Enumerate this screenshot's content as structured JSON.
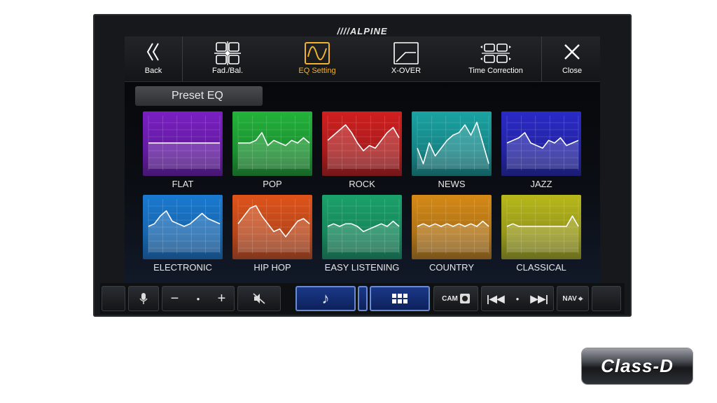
{
  "brand": "////ALPINE",
  "topbar": {
    "back": "Back",
    "fad_bal": "Fad./Bal.",
    "eq_setting": "EQ Setting",
    "xover": "X-OVER",
    "time_correction": "Time Correction",
    "close": "Close"
  },
  "preset_header": "Preset EQ",
  "presets": [
    {
      "name": "FLAT",
      "color": "#7a1fc4",
      "curve": [
        0.5,
        0.5,
        0.5,
        0.5,
        0.5,
        0.5,
        0.5,
        0.5,
        0.5,
        0.5,
        0.5,
        0.5,
        0.5
      ]
    },
    {
      "name": "POP",
      "color": "#22b33a",
      "curve": [
        0.5,
        0.5,
        0.5,
        0.45,
        0.3,
        0.55,
        0.45,
        0.5,
        0.55,
        0.45,
        0.5,
        0.4,
        0.5
      ]
    },
    {
      "name": "ROCK",
      "color": "#d11f1f",
      "curve": [
        0.45,
        0.35,
        0.25,
        0.15,
        0.3,
        0.5,
        0.65,
        0.55,
        0.6,
        0.45,
        0.3,
        0.2,
        0.4
      ]
    },
    {
      "name": "NEWS",
      "color": "#1aa3a3",
      "curve": [
        0.6,
        0.9,
        0.5,
        0.75,
        0.6,
        0.45,
        0.35,
        0.3,
        0.15,
        0.35,
        0.1,
        0.5,
        0.9
      ]
    },
    {
      "name": "JAZZ",
      "color": "#2a2ac8",
      "curve": [
        0.5,
        0.45,
        0.4,
        0.3,
        0.5,
        0.55,
        0.6,
        0.45,
        0.5,
        0.4,
        0.55,
        0.5,
        0.45
      ]
    },
    {
      "name": "ELECTRONIC",
      "color": "#1a7ad1",
      "curve": [
        0.5,
        0.45,
        0.3,
        0.2,
        0.4,
        0.45,
        0.5,
        0.45,
        0.35,
        0.25,
        0.35,
        0.4,
        0.45
      ]
    },
    {
      "name": "HIP HOP",
      "color": "#e0531a",
      "curve": [
        0.45,
        0.3,
        0.15,
        0.1,
        0.3,
        0.45,
        0.6,
        0.55,
        0.7,
        0.55,
        0.4,
        0.35,
        0.45
      ]
    },
    {
      "name": "EASY LISTENING",
      "color": "#1aa26a",
      "curve": [
        0.5,
        0.45,
        0.5,
        0.45,
        0.45,
        0.5,
        0.6,
        0.55,
        0.5,
        0.45,
        0.5,
        0.4,
        0.5
      ]
    },
    {
      "name": "COUNTRY",
      "color": "#d68a16",
      "curve": [
        0.5,
        0.45,
        0.5,
        0.45,
        0.5,
        0.45,
        0.5,
        0.45,
        0.5,
        0.45,
        0.5,
        0.4,
        0.5
      ]
    },
    {
      "name": "CLASSICAL",
      "color": "#b8b81a",
      "curve": [
        0.5,
        0.45,
        0.5,
        0.5,
        0.5,
        0.5,
        0.5,
        0.5,
        0.5,
        0.5,
        0.5,
        0.3,
        0.5
      ]
    }
  ],
  "controls": {
    "cam": "CAM",
    "nav": "NAV"
  },
  "badge": "Class-D"
}
